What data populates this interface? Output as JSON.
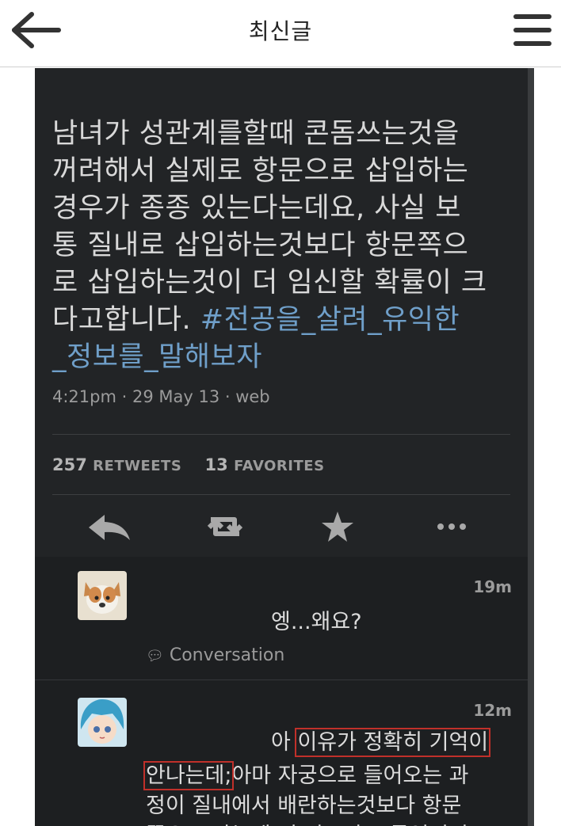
{
  "header": {
    "title": "최신글",
    "back_icon": "arrow-left-icon",
    "menu_icon": "hamburger-menu-icon"
  },
  "tweet": {
    "lines": [
      "남녀가 성관계를할때 콘돔쓰는것을",
      "꺼려해서 실제로 항문으로 삽입하는",
      "경우가 종종 있는다는데요, 사실 보",
      "통 질내로 삽입하는것보다 항문쪽으",
      "로 삽입하는것이 더 임신할 확률이 크",
      "다고합니다."
    ],
    "hashtag_part1": "#전공을_살려_유익한",
    "hashtag_part2": "_정보를_말해보자",
    "meta": "4:21pm · 29 May 13 · web",
    "retweets_count": "257",
    "retweets_label": "RETWEETS",
    "favorites_count": "13",
    "favorites_label": "FAVORITES"
  },
  "actions": {
    "reply_icon": "reply-icon",
    "retweet_icon": "retweet-icon",
    "favorite_icon": "star-icon",
    "more_icon": "more-dots-icon"
  },
  "replies": [
    {
      "time": "19m",
      "text": "엥...왜요?",
      "conversation_label": "Conversation"
    },
    {
      "time": "12m",
      "line1_prefix": "아 ",
      "line1_highlight": "이유가 정확히 기억이",
      "line2_highlight": "안나는데;",
      "line2_rest": "아마 자궁으로 들어오는 과",
      "line3": "정이 질내에서 배란하는것보다 항문",
      "line4": "쪽으로 가는게 더 빠르다고 들었던거"
    }
  ],
  "colors": {
    "screenshot_bg": "#222426",
    "reply_bg": "#1d1f21",
    "text": "#d9d9d9",
    "hashtag": "#6f9fc9",
    "meta": "#9b9b9b",
    "highlight_box": "#c0302a"
  }
}
